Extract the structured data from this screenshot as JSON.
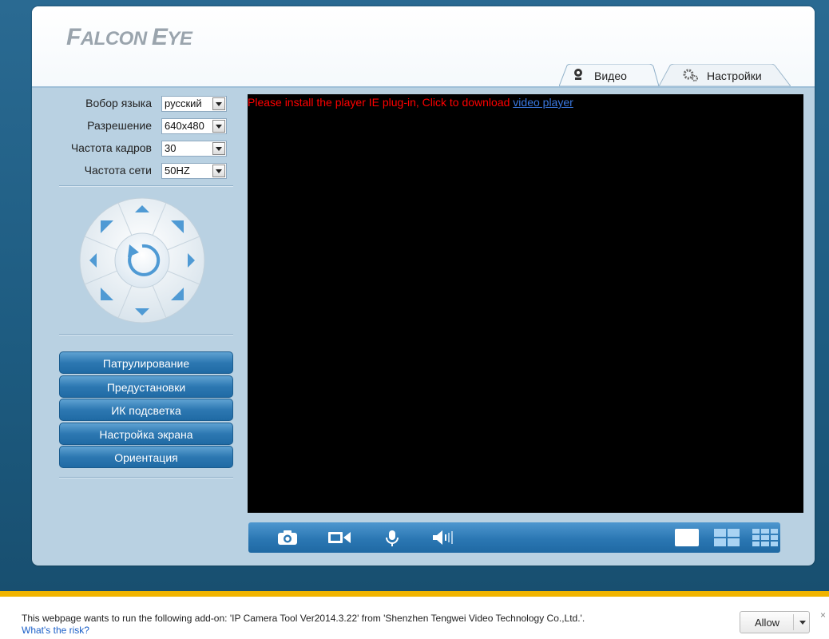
{
  "brand": {
    "logo_text_1": "F",
    "logo_text_2": "ALCON ",
    "logo_text_3": "E",
    "logo_text_4": "YE"
  },
  "tabs": [
    {
      "label": "Видео",
      "icon": "webcam-icon",
      "active": true
    },
    {
      "label": "Настройки",
      "icon": "gears-icon",
      "active": false
    }
  ],
  "settings": {
    "language": {
      "label": "Вобор языка",
      "value": "русский"
    },
    "resolution": {
      "label": "Разрешение",
      "value": "640x480"
    },
    "framerate": {
      "label": "Частота кадров",
      "value": "30"
    },
    "frequency": {
      "label": "Частота сети",
      "value": "50HZ"
    }
  },
  "ptz": {
    "center_icon": "refresh-icon",
    "directions": [
      "up",
      "up-right",
      "right",
      "down-right",
      "down",
      "down-left",
      "left",
      "up-left"
    ]
  },
  "menu": [
    {
      "label": "Патрулирование"
    },
    {
      "label": "Предустановки"
    },
    {
      "label": "ИК подсветка"
    },
    {
      "label": "Настройка экрана"
    },
    {
      "label": "Ориентация"
    }
  ],
  "video": {
    "plugin_message": "Please install the player IE plug-in, Click to download ",
    "plugin_link": "video player"
  },
  "controls": [
    "camera-icon",
    "video-record-icon",
    "microphone-icon",
    "speaker-icon",
    "single-view-icon",
    "quad-view-icon",
    "nine-view-icon"
  ],
  "notification": {
    "text": "This webpage wants to run the following add-on: 'IP Camera Tool Ver2014.3.22' from 'Shenzhen Tengwei Video Technology Co.,Ltd.'.",
    "risk_link": "What's the risk?",
    "allow_label": "Allow",
    "close": "×"
  },
  "colors": {
    "accent": "#2b77b3",
    "panel": "#b9d1e2",
    "warning_bar": "#f0b400",
    "error_text": "#ff0000"
  }
}
